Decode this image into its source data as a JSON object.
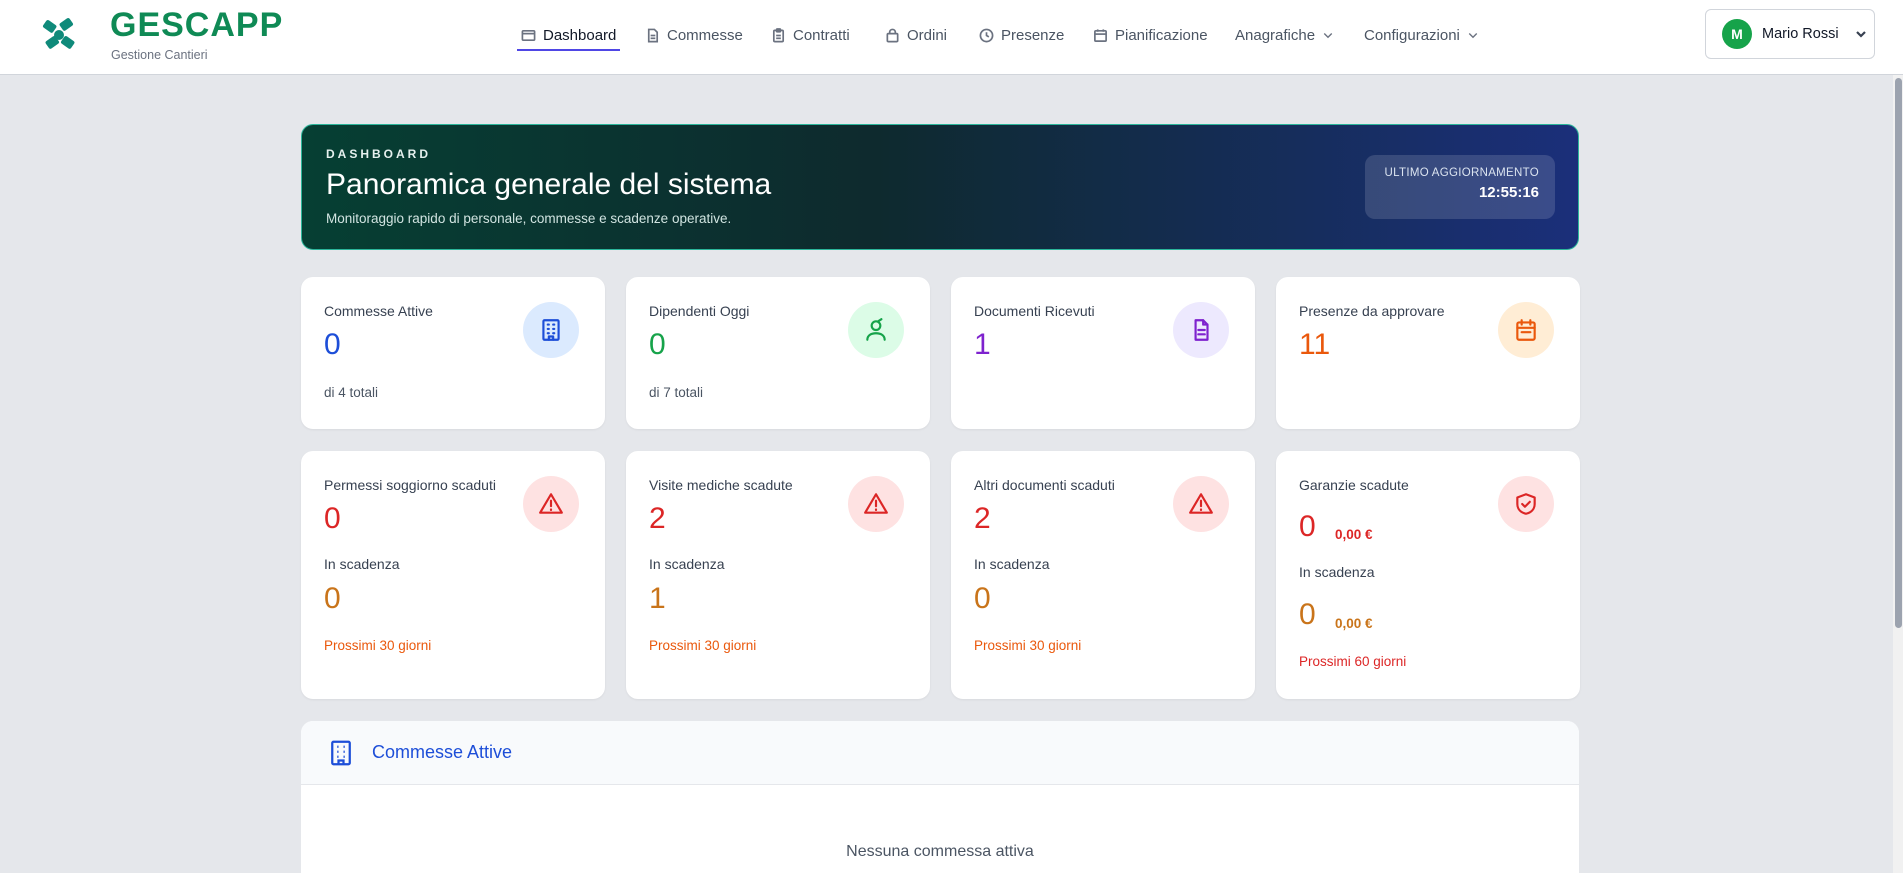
{
  "brand": {
    "name": "GESCAPP",
    "subtitle": "Gestione Cantieri",
    "color": "#0f8a55"
  },
  "nav": {
    "items": [
      {
        "label": "Dashboard",
        "icon": "dashboard-icon",
        "active": true
      },
      {
        "label": "Commesse",
        "icon": "document-icon"
      },
      {
        "label": "Contratti",
        "icon": "clipboard-icon"
      },
      {
        "label": "Ordini",
        "icon": "bag-icon"
      },
      {
        "label": "Presenze",
        "icon": "clock-icon"
      },
      {
        "label": "Pianificazione",
        "icon": "calendar-icon"
      },
      {
        "label": "Anagrafiche",
        "icon": "chevron-down-icon"
      },
      {
        "label": "Configurazioni",
        "icon": "chevron-down-icon"
      }
    ]
  },
  "user": {
    "initial": "M",
    "name": "Mario Rossi"
  },
  "hero": {
    "eyebrow": "DASHBOARD",
    "title": "Panoramica generale del sistema",
    "subtitle": "Monitoraggio rapido di personale, commesse e scadenze operative.",
    "badge_label": "ULTIMO AGGIORNAMENTO",
    "badge_value": "12:55:16"
  },
  "stats": [
    {
      "title": "Commesse Attive",
      "value": "0",
      "foot": "di 4 totali",
      "icon": "building-icon",
      "color": "#1d4ed8"
    },
    {
      "title": "Dipendenti Oggi",
      "value": "0",
      "foot": "di 7 totali",
      "icon": "user-icon",
      "color": "#16a34a"
    },
    {
      "title": "Documenti Ricevuti",
      "value": "1",
      "foot": "",
      "icon": "document-icon",
      "color": "#7e22ce"
    },
    {
      "title": "Presenze da approvare",
      "value": "11",
      "foot": "",
      "icon": "calendar-icon",
      "color": "#ea580c"
    }
  ],
  "expiry": [
    {
      "title": "Permessi soggiorno scaduti",
      "value": "0",
      "sub_label": "In scadenza",
      "sub_value": "0",
      "note": "Prossimi 30 giorni",
      "icon": "warning-icon"
    },
    {
      "title": "Visite mediche scadute",
      "value": "2",
      "sub_label": "In scadenza",
      "sub_value": "1",
      "note": "Prossimi 30 giorni",
      "icon": "warning-icon"
    },
    {
      "title": "Altri documenti scaduti",
      "value": "2",
      "sub_label": "In scadenza",
      "sub_value": "0",
      "note": "Prossimi 30 giorni",
      "icon": "warning-icon"
    },
    {
      "title": "Garanzie scadute",
      "value": "0",
      "money": "0,00 €",
      "sub_label": "In scadenza",
      "sub_value": "0",
      "sub_money": "0,00 €",
      "note": "Prossimi 60 giorni",
      "icon": "shield-check-icon"
    }
  ],
  "commesse_panel": {
    "title": "Commesse Attive",
    "empty": "Nessuna commessa attiva"
  }
}
